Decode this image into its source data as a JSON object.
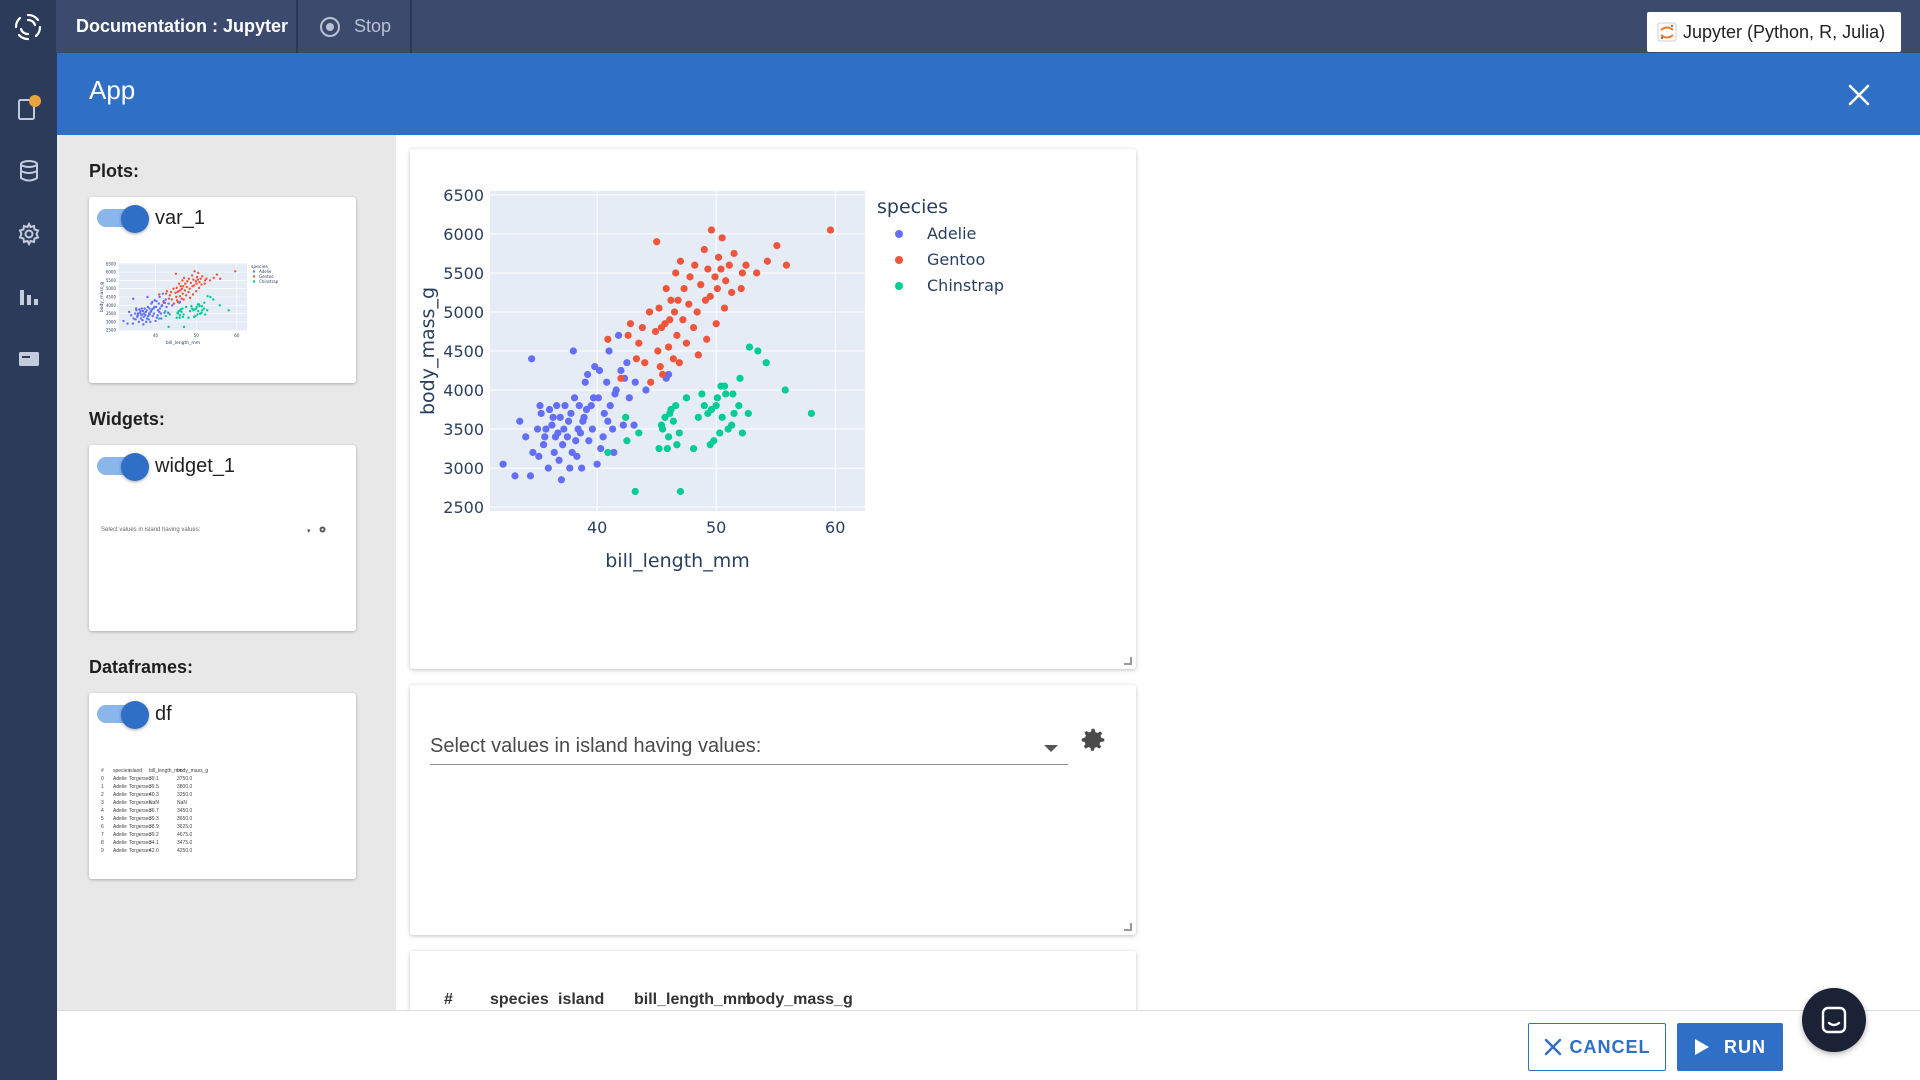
{
  "topbar": {
    "doc_title": "Documentation : Jupyter",
    "stop_label": "Stop",
    "kernel_label": "Jupyter (Python, R, Julia)"
  },
  "rail": {
    "icons": [
      "notebook-icon",
      "database-icon",
      "gear-icon",
      "bar-chart-icon",
      "card-icon"
    ],
    "notification_color": "#e8a33c"
  },
  "app": {
    "title": "App"
  },
  "panel": {
    "plots_label": "Plots:",
    "widgets_label": "Widgets:",
    "dataframes_label": "Dataframes:",
    "plot_card_name": "var_1",
    "widget_card_name": "widget_1",
    "df_card_name": "df",
    "widget_thumb_text": "Select values in island having values:",
    "df_thumb": {
      "header": [
        "#",
        "species",
        "island",
        "bill_length_mm",
        "body_mass_g"
      ],
      "rows": [
        [
          "0",
          "Adelie",
          "Torgersen",
          "39.1",
          "3750.0"
        ],
        [
          "1",
          "Adelie",
          "Torgersen",
          "39.5",
          "3800.0"
        ],
        [
          "2",
          "Adelie",
          "Torgersen",
          "40.3",
          "3250.0"
        ],
        [
          "3",
          "Adelie",
          "Torgersen",
          "NaN",
          "NaN"
        ],
        [
          "4",
          "Adelie",
          "Torgersen",
          "36.7",
          "3450.0"
        ],
        [
          "5",
          "Adelie",
          "Torgersen",
          "39.3",
          "3650.0"
        ],
        [
          "6",
          "Adelie",
          "Torgersen",
          "38.9",
          "3625.0"
        ],
        [
          "7",
          "Adelie",
          "Torgersen",
          "39.2",
          "4675.0"
        ],
        [
          "8",
          "Adelie",
          "Torgersen",
          "34.1",
          "3475.0"
        ],
        [
          "9",
          "Adelie",
          "Torgersen",
          "42.0",
          "4250.0"
        ]
      ]
    }
  },
  "widget": {
    "dropdown_label": "Select values in island having values:"
  },
  "dataframe": {
    "headers": [
      "#",
      "species",
      "island",
      "bill_length_mm",
      "body_mass_g"
    ]
  },
  "footer": {
    "cancel_label": "CANCEL",
    "run_label": "RUN"
  },
  "colors": {
    "accent": "#2f6fc6",
    "adelie": "#636efa",
    "gentoo": "#ef553b",
    "chinstrap": "#00cc96",
    "plot_bg": "#e5ecf6"
  },
  "chart_data": {
    "type": "scatter",
    "title": "",
    "xlabel": "bill_length_mm",
    "ylabel": "body_mass_g",
    "xlim": [
      31,
      62.5
    ],
    "ylim": [
      2450,
      6550
    ],
    "x_ticks": [
      40,
      50,
      60
    ],
    "y_ticks": [
      2500,
      3000,
      3500,
      4000,
      4500,
      5000,
      5500,
      6000,
      6500
    ],
    "grid": true,
    "legend_title": "species",
    "legend_position": "right",
    "series": [
      {
        "name": "Adelie",
        "color": "#636efa",
        "points": [
          [
            32.1,
            3050
          ],
          [
            33.1,
            2900
          ],
          [
            33.5,
            3600
          ],
          [
            34.0,
            3400
          ],
          [
            34.4,
            2900
          ],
          [
            34.5,
            4400
          ],
          [
            34.6,
            3200
          ],
          [
            35.0,
            3500
          ],
          [
            35.1,
            3150
          ],
          [
            35.2,
            3800
          ],
          [
            35.3,
            3700
          ],
          [
            35.5,
            3300
          ],
          [
            35.6,
            3400
          ],
          [
            35.7,
            3500
          ],
          [
            35.9,
            3000
          ],
          [
            36.0,
            3750
          ],
          [
            36.2,
            3550
          ],
          [
            36.3,
            3650
          ],
          [
            36.4,
            3200
          ],
          [
            36.5,
            3400
          ],
          [
            36.6,
            3800
          ],
          [
            36.7,
            3450
          ],
          [
            36.8,
            3100
          ],
          [
            36.9,
            3650
          ],
          [
            37.0,
            2850
          ],
          [
            37.1,
            3300
          ],
          [
            37.2,
            3500
          ],
          [
            37.3,
            3800
          ],
          [
            37.5,
            3400
          ],
          [
            37.6,
            3600
          ],
          [
            37.7,
            3000
          ],
          [
            37.8,
            3700
          ],
          [
            37.9,
            3200
          ],
          [
            38.0,
            4500
          ],
          [
            38.1,
            3900
          ],
          [
            38.2,
            3350
          ],
          [
            38.3,
            3150
          ],
          [
            38.4,
            3500
          ],
          [
            38.5,
            3800
          ],
          [
            38.6,
            3450
          ],
          [
            38.7,
            3000
          ],
          [
            38.8,
            3600
          ],
          [
            38.9,
            3650
          ],
          [
            39.0,
            4100
          ],
          [
            39.1,
            3750
          ],
          [
            39.2,
            4200
          ],
          [
            39.3,
            3350
          ],
          [
            39.5,
            3800
          ],
          [
            39.6,
            3500
          ],
          [
            39.7,
            3900
          ],
          [
            39.8,
            4300
          ],
          [
            40.0,
            3050
          ],
          [
            40.1,
            3900
          ],
          [
            40.2,
            4250
          ],
          [
            40.3,
            3250
          ],
          [
            40.5,
            3400
          ],
          [
            40.6,
            3700
          ],
          [
            40.8,
            4100
          ],
          [
            40.9,
            3600
          ],
          [
            41.0,
            4500
          ],
          [
            41.1,
            3800
          ],
          [
            41.3,
            3500
          ],
          [
            41.4,
            3200
          ],
          [
            41.5,
            3950
          ],
          [
            41.6,
            4000
          ],
          [
            41.8,
            4700
          ],
          [
            42.0,
            4250
          ],
          [
            42.2,
            3550
          ],
          [
            42.3,
            4150
          ],
          [
            42.5,
            4350
          ],
          [
            42.7,
            3900
          ],
          [
            43.1,
            3550
          ],
          [
            43.2,
            4100
          ],
          [
            44.1,
            4000
          ],
          [
            45.8,
            4150
          ],
          [
            46.0,
            4200
          ]
        ]
      },
      {
        "name": "Gentoo",
        "color": "#ef553b",
        "points": [
          [
            40.9,
            4650
          ],
          [
            42.0,
            4150
          ],
          [
            42.6,
            4700
          ],
          [
            42.8,
            4850
          ],
          [
            43.3,
            4400
          ],
          [
            43.5,
            4600
          ],
          [
            43.8,
            4800
          ],
          [
            44.0,
            4350
          ],
          [
            44.4,
            5000
          ],
          [
            44.5,
            4100
          ],
          [
            44.9,
            4750
          ],
          [
            45.0,
            5900
          ],
          [
            45.1,
            4500
          ],
          [
            45.2,
            5050
          ],
          [
            45.3,
            4300
          ],
          [
            45.4,
            4800
          ],
          [
            45.5,
            4200
          ],
          [
            45.7,
            4850
          ],
          [
            45.8,
            5300
          ],
          [
            46.0,
            4550
          ],
          [
            46.1,
            4900
          ],
          [
            46.2,
            5150
          ],
          [
            46.4,
            4400
          ],
          [
            46.5,
            5000
          ],
          [
            46.6,
            5500
          ],
          [
            46.7,
            4700
          ],
          [
            46.8,
            5150
          ],
          [
            46.9,
            4350
          ],
          [
            47.0,
            5650
          ],
          [
            47.2,
            4900
          ],
          [
            47.3,
            5300
          ],
          [
            47.5,
            4600
          ],
          [
            47.7,
            5100
          ],
          [
            47.8,
            5450
          ],
          [
            48.1,
            4800
          ],
          [
            48.2,
            5600
          ],
          [
            48.4,
            5000
          ],
          [
            48.5,
            4450
          ],
          [
            48.7,
            5350
          ],
          [
            49.0,
            5800
          ],
          [
            49.1,
            5150
          ],
          [
            49.2,
            4650
          ],
          [
            49.3,
            5550
          ],
          [
            49.5,
            5200
          ],
          [
            49.6,
            6050
          ],
          [
            49.9,
            5450
          ],
          [
            50.0,
            4850
          ],
          [
            50.1,
            5300
          ],
          [
            50.2,
            5700
          ],
          [
            50.4,
            5550
          ],
          [
            50.5,
            5950
          ],
          [
            50.7,
            5050
          ],
          [
            50.8,
            5400
          ],
          [
            51.1,
            5600
          ],
          [
            51.3,
            5250
          ],
          [
            51.5,
            5750
          ],
          [
            52.1,
            5300
          ],
          [
            52.2,
            5500
          ],
          [
            52.5,
            5600
          ],
          [
            53.4,
            5500
          ],
          [
            54.3,
            5650
          ],
          [
            55.1,
            5850
          ],
          [
            55.9,
            5600
          ],
          [
            59.6,
            6050
          ]
        ]
      },
      {
        "name": "Chinstrap",
        "color": "#00cc96",
        "points": [
          [
            40.9,
            3200
          ],
          [
            42.4,
            3650
          ],
          [
            42.5,
            3350
          ],
          [
            43.2,
            2700
          ],
          [
            43.5,
            3450
          ],
          [
            45.2,
            3250
          ],
          [
            45.4,
            3550
          ],
          [
            45.5,
            3500
          ],
          [
            45.7,
            3650
          ],
          [
            45.9,
            3250
          ],
          [
            46.0,
            3400
          ],
          [
            46.1,
            3700
          ],
          [
            46.2,
            3750
          ],
          [
            46.4,
            3600
          ],
          [
            46.6,
            3800
          ],
          [
            46.7,
            3300
          ],
          [
            46.9,
            3450
          ],
          [
            47.0,
            2700
          ],
          [
            47.5,
            3900
          ],
          [
            48.1,
            3250
          ],
          [
            48.5,
            3650
          ],
          [
            48.8,
            3950
          ],
          [
            49.0,
            3800
          ],
          [
            49.3,
            3700
          ],
          [
            49.5,
            3300
          ],
          [
            49.6,
            3750
          ],
          [
            49.8,
            3350
          ],
          [
            50.0,
            3800
          ],
          [
            50.1,
            3900
          ],
          [
            50.3,
            3450
          ],
          [
            50.4,
            4050
          ],
          [
            50.5,
            3650
          ],
          [
            50.7,
            4050
          ],
          [
            50.8,
            3950
          ],
          [
            51.0,
            3500
          ],
          [
            51.3,
            3550
          ],
          [
            51.4,
            3950
          ],
          [
            51.5,
            3700
          ],
          [
            51.9,
            3800
          ],
          [
            52.0,
            4150
          ],
          [
            52.2,
            3450
          ],
          [
            52.7,
            3700
          ],
          [
            52.8,
            4550
          ],
          [
            53.5,
            4500
          ],
          [
            54.2,
            4350
          ],
          [
            55.8,
            4000
          ],
          [
            58.0,
            3700
          ]
        ]
      }
    ]
  }
}
